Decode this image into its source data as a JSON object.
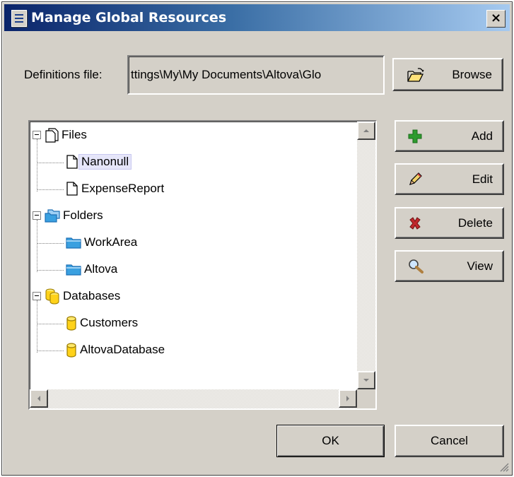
{
  "dialog": {
    "title": "Manage Global Resources",
    "close_glyph": "×"
  },
  "definitions": {
    "label": "Definitions file:",
    "value": "ttings\\My\\My Documents\\Altova\\Glo",
    "browse_label": "Browse"
  },
  "tree": {
    "groups": [
      {
        "label": "Files",
        "icon": "files-group-icon",
        "children": [
          {
            "label": "Nanonull",
            "icon": "file-icon",
            "selected": true
          },
          {
            "label": "ExpenseReport",
            "icon": "file-icon",
            "selected": false
          }
        ]
      },
      {
        "label": "Folders",
        "icon": "folders-group-icon",
        "children": [
          {
            "label": "WorkArea",
            "icon": "folder-icon",
            "selected": false
          },
          {
            "label": "Altova",
            "icon": "folder-icon",
            "selected": false
          }
        ]
      },
      {
        "label": "Databases",
        "icon": "databases-group-icon",
        "children": [
          {
            "label": "Customers",
            "icon": "database-icon",
            "selected": false
          },
          {
            "label": "AltovaDatabase",
            "icon": "database-icon",
            "selected": false
          }
        ]
      }
    ]
  },
  "actions": {
    "add": "Add",
    "edit": "Edit",
    "delete": "Delete",
    "view": "View"
  },
  "footer": {
    "ok": "OK",
    "cancel": "Cancel"
  },
  "colors": {
    "titlebar_start": "#0a246a",
    "titlebar_end": "#a6caf0",
    "face": "#d4d0c8",
    "selection": "#e6e6fa",
    "add_icon": "#2e9b2e",
    "delete_icon": "#c0282d",
    "folder_icon": "#3aa0e0",
    "database_icon": "#ffd21a"
  }
}
